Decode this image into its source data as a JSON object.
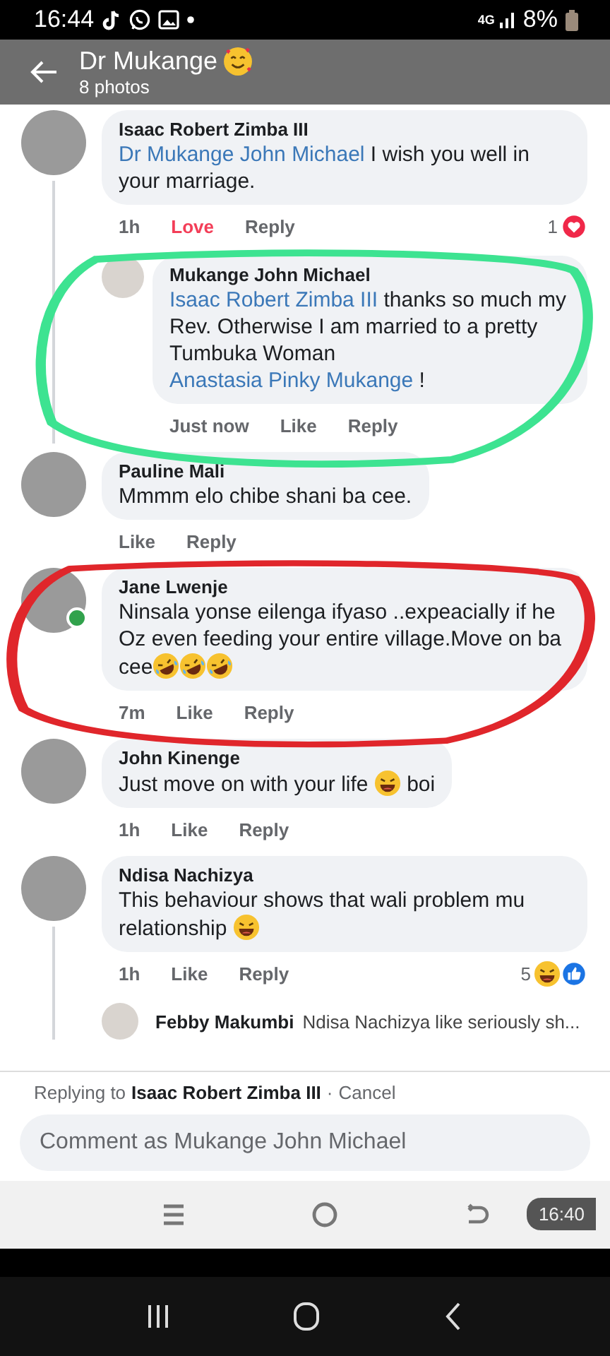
{
  "status_bar": {
    "time": "16:44",
    "network": "4G",
    "battery": "8%"
  },
  "header": {
    "title": "Dr Mukange",
    "subtitle": "8 photos"
  },
  "comments": [
    {
      "kind": "full",
      "author": "Isaac Robert Zimba III",
      "segments": [
        {
          "kind": "mention",
          "text": "Dr Mukange John Michael"
        },
        {
          "kind": "plain",
          "text": " I wish you well in your marriage."
        }
      ],
      "time": "1h",
      "like_label": "Love",
      "reacted": true,
      "reply_label": "Reply",
      "reaction_count": "1",
      "reactions": [
        {
          "kind": "love"
        }
      ],
      "children": [
        {
          "kind": "full",
          "author": "Mukange John Michael",
          "segments": [
            {
              "kind": "mention",
              "text": "Isaac Robert Zimba III"
            },
            {
              "kind": "plain",
              "text": " thanks so much my Rev. Otherwise I am married to a pretty Tumbuka Woman "
            },
            {
              "kind": "mention",
              "text": "Anastasia Pinky Mukange"
            },
            {
              "kind": "plain",
              "text": " !"
            }
          ],
          "time": "Just now",
          "like_label": "Like",
          "reacted": false,
          "reply_label": "Reply",
          "highlight": {
            "color": "#3de391"
          }
        }
      ]
    },
    {
      "kind": "full",
      "author": "Pauline Mali",
      "segments": [
        {
          "kind": "plain",
          "text": "Mmmm elo chibe shani ba cee."
        }
      ],
      "like_label": "Like",
      "reacted": false,
      "reply_label": "Reply"
    },
    {
      "kind": "full",
      "author": "Jane Lwenje",
      "online": true,
      "segments": [
        {
          "kind": "plain",
          "text": "Ninsala yonse eilenga ifyaso ..expeacially if he Oz even feeding your entire village.Move on ba cee"
        },
        {
          "kind": "rofl"
        },
        {
          "kind": "rofl"
        },
        {
          "kind": "rofl"
        }
      ],
      "time": "7m",
      "like_label": "Like",
      "reacted": false,
      "reply_label": "Reply",
      "highlight": {
        "color": "#e0262b"
      }
    },
    {
      "kind": "full",
      "author": "John Kinenge",
      "segments": [
        {
          "kind": "plain",
          "text": "Just move on with your life "
        },
        {
          "kind": "laugh"
        },
        {
          "kind": "plain",
          "text": " boi"
        }
      ],
      "time": "1h",
      "like_label": "Like",
      "reacted": false,
      "reply_label": "Reply"
    },
    {
      "kind": "full",
      "author": "Ndisa Nachizya",
      "segments": [
        {
          "kind": "plain",
          "text": "This behaviour shows that wali problem mu relationship "
        },
        {
          "kind": "laugh"
        }
      ],
      "time": "1h",
      "like_label": "Like",
      "reacted": false,
      "reply_label": "Reply",
      "reaction_count": "5",
      "reactions": [
        {
          "kind": "haha"
        },
        {
          "kind": "like"
        }
      ],
      "children": [
        {
          "kind": "preview",
          "author": "Febby Makumbi",
          "preview": "Ndisa Nachizya like  seriously sh..."
        }
      ]
    }
  ],
  "reply_bar": {
    "prefix": "Replying to",
    "name": "Isaac Robert Zimba III",
    "separator": "·",
    "cancel": "Cancel"
  },
  "composer": {
    "placeholder": "Comment as Mukange John Michael"
  },
  "inner_nav": {
    "toast": "16:40"
  }
}
